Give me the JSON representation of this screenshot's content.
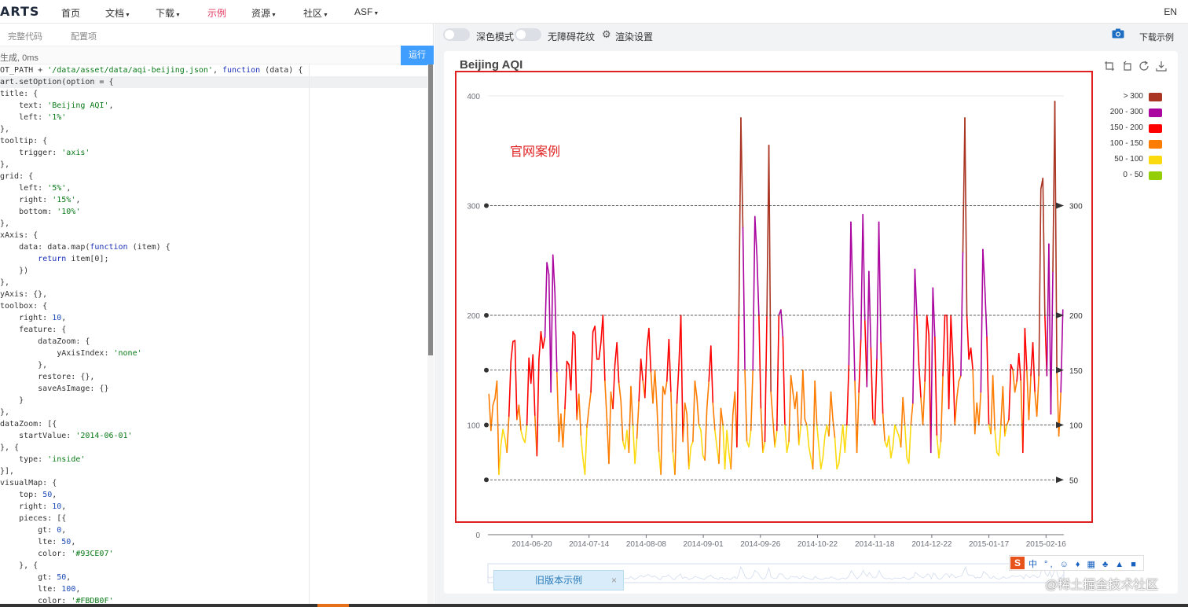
{
  "nav": {
    "logo": "ARTS",
    "items": [
      {
        "label": "首页"
      },
      {
        "label": "文档"
      },
      {
        "label": "下载"
      },
      {
        "label": "示例"
      },
      {
        "label": "资源"
      },
      {
        "label": "社区"
      },
      {
        "label": "ASF"
      }
    ],
    "lang": "EN"
  },
  "editor": {
    "tabs": [
      "完整代码",
      "配置项"
    ],
    "status": "生成, 0ms",
    "run_label": "运行",
    "code_lines": [
      "OT_PATH + '/data/asset/data/aqi-beijing.json', function (data) {",
      "art.setOption(option = {",
      "title: {",
      "    text: 'Beijing AQI',",
      "    left: '1%'",
      "},",
      "tooltip: {",
      "    trigger: 'axis'",
      "},",
      "grid: {",
      "    left: '5%',",
      "    right: '15%',",
      "    bottom: '10%'",
      "},",
      "xAxis: {",
      "    data: data.map(function (item) {",
      "        return item[0];",
      "    })",
      "},",
      "yAxis: {},",
      "toolbox: {",
      "    right: 10,",
      "    feature: {",
      "        dataZoom: {",
      "            yAxisIndex: 'none'",
      "        },",
      "        restore: {},",
      "        saveAsImage: {}",
      "    }",
      "},",
      "dataZoom: [{",
      "    startValue: '2014-06-01'",
      "}, {",
      "    type: 'inside'",
      "}],",
      "visualMap: {",
      "    top: 50,",
      "    right: 10,",
      "    pieces: [{",
      "        gt: 0,",
      "        lte: 50,",
      "        color: '#93CE07'",
      "    }, {",
      "        gt: 50,",
      "        lte: 100,",
      "        color: '#FBDB0F'"
    ]
  },
  "toolbar": {
    "dark_mode": "深色模式",
    "decal": "无障碍花纹",
    "render_settings": "渲染设置",
    "download": "下载示例"
  },
  "annotation": "官网案例",
  "old_version": "旧版本示例",
  "old_close": "×",
  "ime": {
    "logo": "S",
    "text": "中 °, ☺ ♦ ▦ ♣ ▲ ■"
  },
  "watermark": "@稀土掘金技术社区",
  "colors": {
    "accent": "#e43961",
    "run": "#409eff",
    "annotation": "#e02020"
  },
  "chart_data": {
    "type": "line",
    "title": "Beijing AQI",
    "ylim": [
      0,
      400
    ],
    "yticks": [
      0,
      100,
      200,
      300,
      400
    ],
    "x_ticks": [
      "2014-06-20",
      "2014-07-14",
      "2014-08-08",
      "2014-09-01",
      "2014-09-26",
      "2014-10-22",
      "2014-11-18",
      "2014-12-22",
      "2015-01-17",
      "2015-02-16"
    ],
    "mark_lines": [
      50,
      100,
      150,
      200,
      300
    ],
    "legend": [
      {
        "label": "> 300",
        "color": "#AA3523"
      },
      {
        "label": "200 - 300",
        "color": "#AA069F"
      },
      {
        "label": "150 - 200",
        "color": "#FD0100"
      },
      {
        "label": "100 - 150",
        "color": "#FC7D02"
      },
      {
        "label": "50 - 100",
        "color": "#FBDB0F"
      },
      {
        "label": "0 - 50",
        "color": "#93CE07"
      }
    ],
    "values": [
      128,
      95,
      118,
      124,
      140,
      55,
      82,
      96,
      88,
      75,
      108,
      158,
      176,
      177,
      105,
      118,
      95,
      88,
      84,
      100,
      161,
      138,
      164,
      108,
      72,
      160,
      185,
      170,
      180,
      248,
      237,
      130,
      255,
      220,
      148,
      85,
      110,
      80,
      115,
      158,
      155,
      132,
      185,
      182,
      105,
      128,
      90,
      70,
      55,
      98,
      115,
      130,
      185,
      190,
      160,
      160,
      175,
      200,
      140,
      105,
      65,
      130,
      115,
      155,
      175,
      138,
      122,
      85,
      78,
      95,
      75,
      135,
      100,
      65,
      88,
      122,
      160,
      140,
      125,
      170,
      188,
      148,
      120,
      150,
      118,
      75,
      55,
      135,
      128,
      140,
      178,
      130,
      75,
      55,
      120,
      155,
      200,
      85,
      120,
      110,
      60,
      80,
      85,
      140,
      125,
      100,
      95,
      72,
      68,
      115,
      140,
      172,
      120,
      95,
      80,
      65,
      115,
      100,
      60,
      95,
      75,
      60,
      110,
      130,
      80,
      200,
      380,
      280,
      150,
      85,
      80,
      95,
      150,
      290,
      255,
      200,
      115,
      75,
      85,
      200,
      355,
      130,
      105,
      80,
      95,
      200,
      205,
      180,
      100,
      75,
      85,
      145,
      130,
      115,
      130,
      82,
      100,
      150,
      105,
      100,
      80,
      70,
      60,
      140,
      100,
      80,
      60,
      70,
      90,
      100,
      90,
      130,
      105,
      88,
      60,
      65,
      82,
      100,
      75,
      100,
      155,
      285,
      215,
      140,
      75,
      130,
      178,
      292,
      195,
      135,
      240,
      170,
      105,
      100,
      160,
      285,
      175,
      110,
      85,
      80,
      90,
      70,
      80,
      100,
      95,
      90,
      80,
      125,
      100,
      70,
      65,
      100,
      120,
      242,
      200,
      155,
      125,
      100,
      140,
      200,
      182,
      75,
      225,
      180,
      90,
      70,
      85,
      145,
      200,
      200,
      115,
      200,
      160,
      100,
      125,
      140,
      145,
      258,
      380,
      200,
      160,
      170,
      150,
      92,
      120,
      100,
      130,
      260,
      225,
      180,
      100,
      92,
      145,
      95,
      75,
      72,
      100,
      135,
      90,
      100,
      105,
      155,
      150,
      130,
      140,
      165,
      140,
      75,
      188,
      150,
      105,
      145,
      175,
      130,
      108,
      145,
      315,
      325,
      200,
      145,
      265,
      110,
      240,
      395,
      150,
      90,
      130,
      205
    ]
  }
}
